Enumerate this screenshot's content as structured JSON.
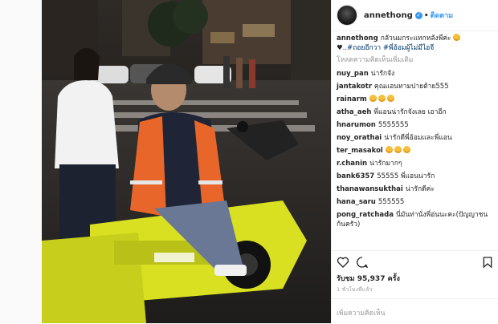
{
  "header": {
    "username": "annethong",
    "separator": "•",
    "follow_label": "ติดตาม"
  },
  "caption": {
    "username": "annethong",
    "text": "กลัวนมกระแทกหลังพี่ค่ะ",
    "line2": "..",
    "hashtag1": "#ถอยอีกวา",
    "hashtag2": "#พี่อ้อมผู้ไม่มีไอจี"
  },
  "load_more": "โหลดความคิดเห็นเพิ่มเติม",
  "comments": [
    {
      "user": "nuy_pan",
      "text": "น่ารักจัง"
    },
    {
      "user": "jantakotr",
      "text": "คุณแอนทามปายต้าย555"
    },
    {
      "user": "rainarm",
      "text": ""
    },
    {
      "user": "atha_aeh",
      "text": "พี่แอนน่ารักจังเลย เอาอีก"
    },
    {
      "user": "hnarumon",
      "text": "5555555"
    },
    {
      "user": "noy_orathai",
      "text": "น่ารักดีพี่อ้อมและพี่แอน"
    },
    {
      "user": "ter_masakol",
      "text": ""
    },
    {
      "user": "r.chanin",
      "text": "น่ารักมากๆ"
    },
    {
      "user": "bank6357",
      "text": "55555 พี่แอนน่ารัก"
    },
    {
      "user": "thanawansukthai",
      "text": "น่ารักดีค่ะ"
    },
    {
      "user": "hana_saru",
      "text": "555555"
    },
    {
      "user": "pong_ratchada",
      "text": "นี่มันท่านั่งพี่อ่นนะคะ(ปัญญาชนก้นครัว)"
    }
  ],
  "likes": "รับชม 95,937 ครั้ง",
  "timestamp": "1 ชั่วโมงที่แล้ว",
  "add_comment_placeholder": "เพิ่มความคิดเห็น",
  "colors": {
    "accent": "#3897f0",
    "vest": "#e8662a",
    "bike": "#d9e021"
  },
  "icons": {
    "verified": "verified-badge-icon",
    "like": "heart-icon",
    "comment": "comment-icon",
    "save": "bookmark-icon"
  }
}
